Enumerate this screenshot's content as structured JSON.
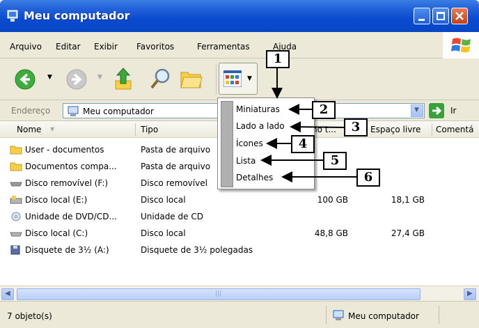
{
  "window": {
    "title": "Meu computador"
  },
  "menu": [
    "Arquivo",
    "Editar",
    "Exibir",
    "Favoritos",
    "Ferramentas",
    "Ajuda"
  ],
  "address": {
    "label": "Endereço",
    "value": "Meu computador",
    "go_label": "Ir"
  },
  "columns": [
    "Nome",
    "Tipo",
    "no t...",
    "Espaço livre",
    "Comentá"
  ],
  "rows": [
    {
      "icon": "folder-icon",
      "name": "User - documentos",
      "type": "Pasta de arquivo",
      "size": "",
      "free": ""
    },
    {
      "icon": "folder-icon",
      "name": "Documentos compa...",
      "type": "Pasta de arquivo",
      "size": "",
      "free": ""
    },
    {
      "icon": "removable-disk-icon",
      "name": "Disco removível (F:)",
      "type": "Disco removível",
      "size": "",
      "free": ""
    },
    {
      "icon": "local-disk-icon",
      "name": "Disco local (E:)",
      "type": "Disco local",
      "size": "100 GB",
      "free": "18,1 GB"
    },
    {
      "icon": "cd-drive-icon",
      "name": "Unidade de DVD/CD...",
      "type": "Unidade de CD",
      "size": "",
      "free": ""
    },
    {
      "icon": "local-disk-icon",
      "name": "Disco local (C:)",
      "type": "Disco local",
      "size": "48,8 GB",
      "free": "27,4 GB"
    },
    {
      "icon": "floppy-icon",
      "name": "Disquete de 3½ (A:)",
      "type": "Disquete de 3½ polegadas",
      "size": "",
      "free": ""
    }
  ],
  "view_menu": [
    "Miniaturas",
    "Lado a lado",
    "Ícones",
    "Lista",
    "Detalhes"
  ],
  "callouts": [
    "1",
    "2",
    "3",
    "4",
    "5",
    "6"
  ],
  "status": {
    "count": "7 objeto(s)",
    "location": "Meu computador"
  },
  "colors": {
    "title_blue": "#0a4bd0",
    "menu_bg": "#ece9d8",
    "close_red": "#c2401a",
    "folder_yellow": "#f5cf4a"
  }
}
